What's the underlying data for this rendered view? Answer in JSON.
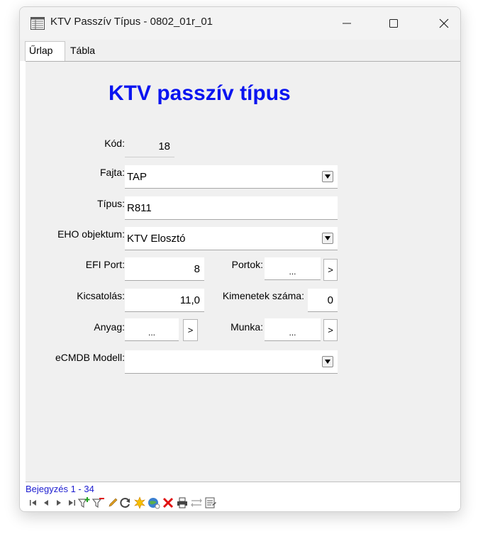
{
  "window": {
    "title": "KTV Passzív Típus - 0802_01r_01"
  },
  "tabs": [
    {
      "label": "Űrlap",
      "active": true
    },
    {
      "label": "Tábla",
      "active": false
    }
  ],
  "form": {
    "heading": "KTV passzív típus",
    "kod": {
      "label": "Kód:",
      "value": "18"
    },
    "fajta": {
      "label": "Fajta:",
      "value": "TAP"
    },
    "tipus": {
      "label": "Típus:",
      "value": "R811"
    },
    "eho": {
      "label": "EHO objektum:",
      "value": "KTV Elosztó"
    },
    "efi_port": {
      "label": "EFI Port:",
      "value": "8"
    },
    "portok": {
      "label": "Portok:",
      "value": "...",
      "arrow": ">"
    },
    "kicsatolas": {
      "label": "Kicsatolás:",
      "value": "11,0"
    },
    "kimenetek": {
      "label": "Kimenetek száma:",
      "value": "0"
    },
    "anyag": {
      "label": "Anyag:",
      "value": "...",
      "arrow": ">"
    },
    "munka": {
      "label": "Munka:",
      "value": "...",
      "arrow": ">"
    },
    "ecmdb": {
      "label": "eCMDB Modell:",
      "value": ""
    }
  },
  "status": {
    "record_text": "Bejegyzés 1 - 34"
  },
  "icons": {
    "app": "table-form-icon",
    "minimize": "minimize-icon",
    "maximize": "maximize-icon",
    "close": "close-icon",
    "nav": [
      "first-record-icon",
      "previous-record-icon",
      "next-record-icon",
      "last-record-icon",
      "add-filter-icon",
      "remove-filter-icon",
      "edit-icon",
      "refresh-icon",
      "new-record-icon",
      "web-globe-icon",
      "delete-icon",
      "print-icon",
      "transfer-icon",
      "form-view-icon"
    ]
  },
  "colors": {
    "heading": "#0a14f0",
    "status_text": "#1c1cd0",
    "delete_red": "#e01010",
    "filter_green": "#20a020"
  }
}
